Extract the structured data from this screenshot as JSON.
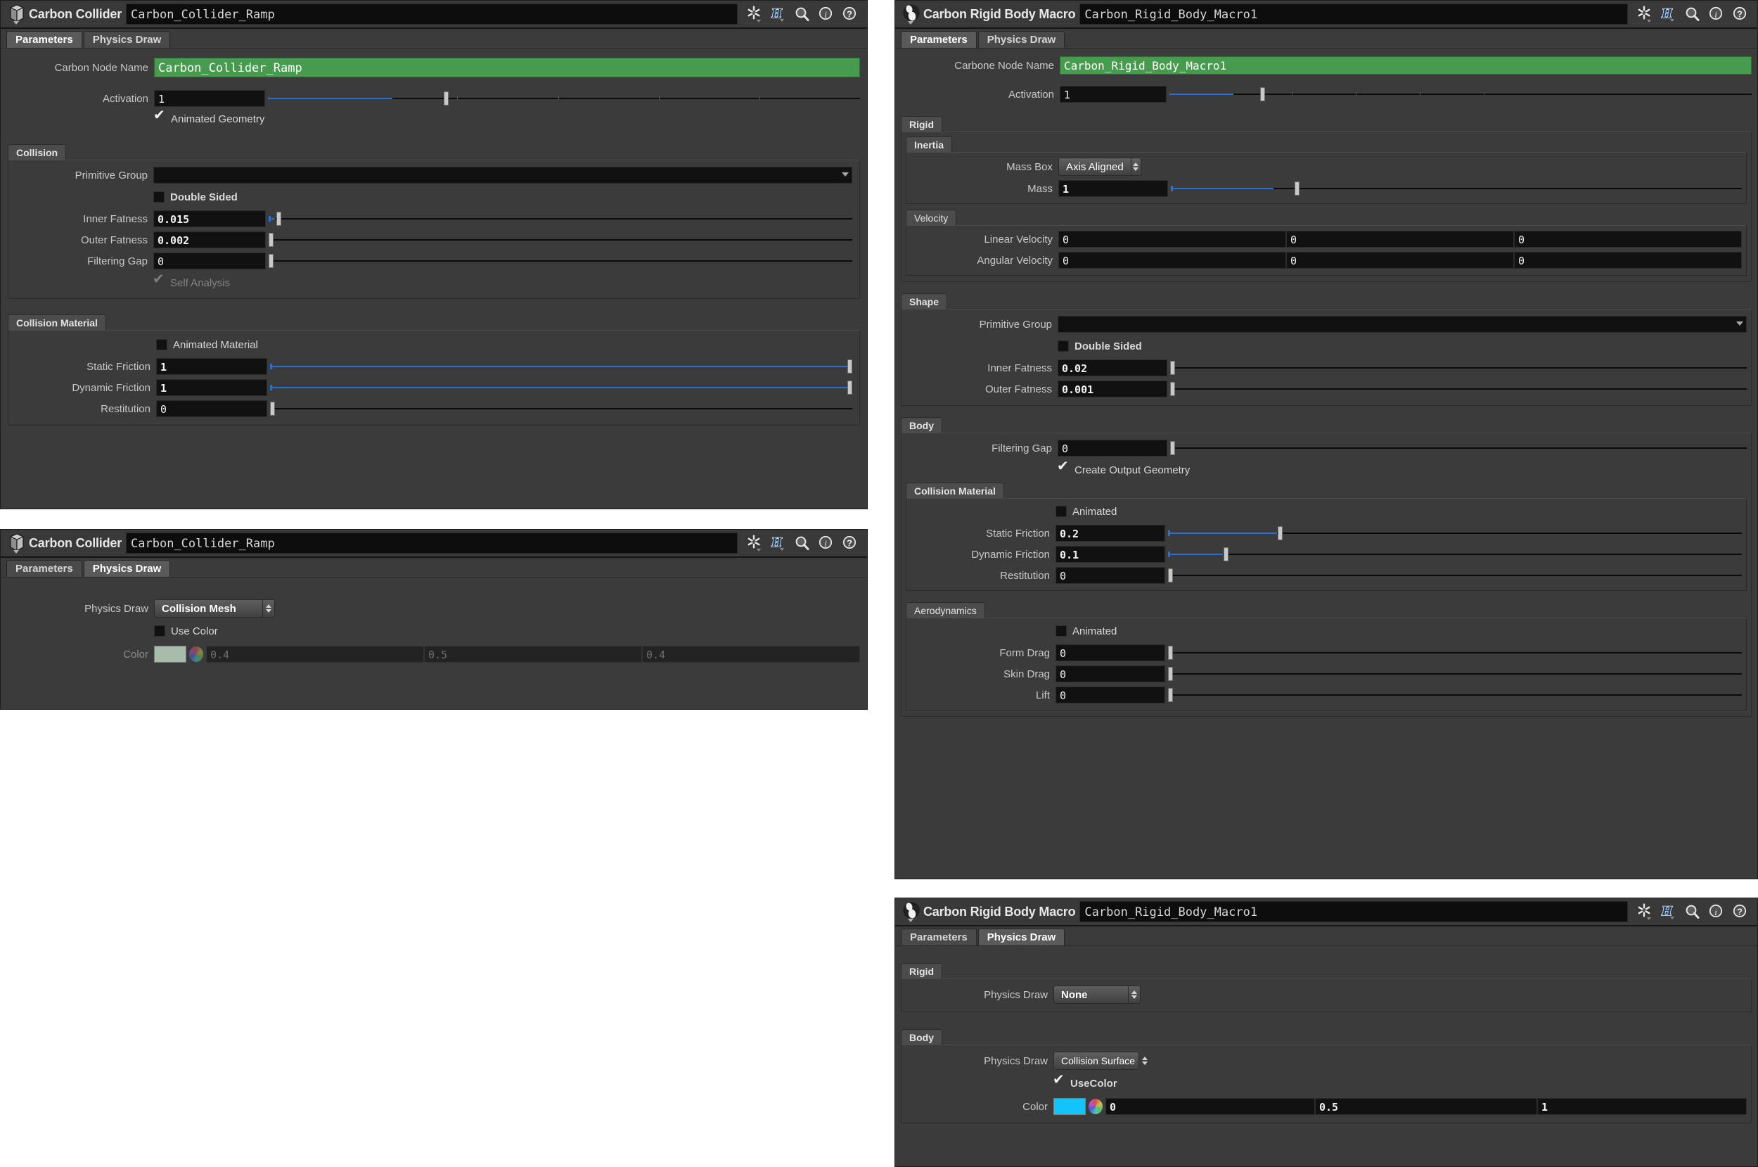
{
  "panels": {
    "collider_params": {
      "title": "Carbon Collider",
      "node_path": "Carbon_Collider_Ramp",
      "node_icon": "box-node-icon",
      "tabs": [
        {
          "label": "Parameters",
          "selected": true
        },
        {
          "label": "Physics Draw",
          "selected": false
        }
      ],
      "toolbar_icons": [
        "gear-icon",
        "houdini-h-icon",
        "search-icon",
        "info-icon",
        "help-icon"
      ],
      "node_name": {
        "label": "Carbon Node Name",
        "value": "Carbon_Collider_Ramp",
        "color": "#479b4e"
      },
      "activation": {
        "label": "Activation",
        "value": "1",
        "fill_pct": 21,
        "knob_pct": 30
      },
      "animated_geometry": {
        "label": "Animated Geometry",
        "checked": true
      },
      "collision": {
        "group": "Collision",
        "primitive_group": {
          "label": "Primitive Group",
          "value": ""
        },
        "double_sided": {
          "label": "Double Sided",
          "checked": false
        },
        "inner_fatness": {
          "label": "Inner Fatness",
          "value": "0.015",
          "fill_pct": 2,
          "knob_pct": 2
        },
        "outer_fatness": {
          "label": "Outer Fatness",
          "value": "0.002",
          "fill_pct": 0,
          "knob_pct": 0
        },
        "filtering_gap": {
          "label": "Filtering Gap",
          "value": "0",
          "fill_pct": 0,
          "knob_pct": 0
        },
        "self_analysis": {
          "label": "Self Analysis",
          "checked": true,
          "disabled": true
        }
      },
      "collision_material": {
        "group": "Collision Material",
        "animated_material": {
          "label": "Animated Material",
          "checked": false
        },
        "static_friction": {
          "label": "Static Friction",
          "value": "1",
          "fill_pct": 100,
          "knob_pct": 100
        },
        "dynamic_friction": {
          "label": "Dynamic Friction",
          "value": "1",
          "fill_pct": 100,
          "knob_pct": 100
        },
        "restitution": {
          "label": "Restitution",
          "value": "0",
          "fill_pct": 0,
          "knob_pct": 0
        }
      }
    },
    "collider_draw": {
      "title": "Carbon Collider",
      "node_path": "Carbon_Collider_Ramp",
      "node_icon": "box-node-icon",
      "tabs": [
        {
          "label": "Parameters",
          "selected": false
        },
        {
          "label": "Physics Draw",
          "selected": true
        }
      ],
      "toolbar_icons": [
        "gear-icon",
        "houdini-h-icon",
        "search-icon",
        "info-icon",
        "help-icon"
      ],
      "physics_draw": {
        "label": "Physics Draw",
        "value": "Collision Mesh"
      },
      "use_color": {
        "label": "Use Color",
        "checked": false
      },
      "color": {
        "label": "Color",
        "swatch": "#a7bcaa",
        "r": "0.4",
        "g": "0.5",
        "b": "0.4",
        "disabled": true
      }
    },
    "rigid_params": {
      "title": "Carbon Rigid Body Macro",
      "node_path": "Carbon_Rigid_Body_Macro1",
      "node_icon": "rigid-body-node-icon",
      "tabs": [
        {
          "label": "Parameters",
          "selected": true
        },
        {
          "label": "Physics Draw",
          "selected": false
        }
      ],
      "toolbar_icons": [
        "gear-icon",
        "houdini-h-icon",
        "search-icon",
        "info-icon",
        "help-icon"
      ],
      "node_name": {
        "label": "Carbone Node Name",
        "value": "Carbon_Rigid_Body_Macro1",
        "color": "#479b4e"
      },
      "activation": {
        "label": "Activation",
        "value": "1",
        "fill_pct": 11,
        "knob_pct": 16
      },
      "rigid": {
        "group": "Rigid",
        "inertia": {
          "group": "Inertia",
          "mass_box": {
            "label": "Mass Box",
            "value": "Axis Aligned"
          },
          "mass": {
            "label": "Mass",
            "value": "1",
            "fill_pct": 18,
            "knob_pct": 22
          }
        },
        "velocity": {
          "group": "Velocity",
          "linear": {
            "label": "Linear Velocity",
            "x": "0",
            "y": "0",
            "z": "0"
          },
          "angular": {
            "label": "Angular Velocity",
            "x": "0",
            "y": "0",
            "z": "0"
          }
        }
      },
      "shape": {
        "group": "Shape",
        "primitive_group": {
          "label": "Primitive Group",
          "value": ""
        },
        "double_sided": {
          "label": "Double Sided",
          "checked": false
        },
        "inner_fatness": {
          "label": "Inner Fatness",
          "value": "0.02",
          "fill_pct": 0,
          "knob_pct": 0
        },
        "outer_fatness": {
          "label": "Outer Fatness",
          "value": "0.001",
          "fill_pct": 0,
          "knob_pct": 0
        }
      },
      "body": {
        "group": "Body",
        "filtering_gap": {
          "label": "Filtering Gap",
          "value": "0",
          "fill_pct": 0,
          "knob_pct": 0
        },
        "create_output_geometry": {
          "label": "Create Output Geometry",
          "checked": true
        },
        "collision_material": {
          "group": "Collision Material",
          "animated": {
            "label": "Animated",
            "checked": false
          },
          "static_friction": {
            "label": "Static Friction",
            "value": "0.2",
            "fill_pct": 20,
            "knob_pct": 20
          },
          "dynamic_friction": {
            "label": "Dynamic Friction",
            "value": "0.1",
            "fill_pct": 10,
            "knob_pct": 10
          },
          "restitution": {
            "label": "Restitution",
            "value": "0",
            "fill_pct": 0,
            "knob_pct": 0
          }
        },
        "aerodynamics": {
          "group": "Aerodynamics",
          "animated": {
            "label": "Animated",
            "checked": false
          },
          "form_drag": {
            "label": "Form Drag",
            "value": "0",
            "fill_pct": 0,
            "knob_pct": 0
          },
          "skin_drag": {
            "label": "Skin Drag",
            "value": "0",
            "fill_pct": 0,
            "knob_pct": 0
          },
          "lift": {
            "label": "Lift",
            "value": "0",
            "fill_pct": 0,
            "knob_pct": 0
          }
        }
      }
    },
    "rigid_draw": {
      "title": "Carbon Rigid Body Macro",
      "node_path": "Carbon_Rigid_Body_Macro1",
      "node_icon": "rigid-body-node-icon",
      "tabs": [
        {
          "label": "Parameters",
          "selected": false
        },
        {
          "label": "Physics Draw",
          "selected": true
        }
      ],
      "toolbar_icons": [
        "gear-icon",
        "houdini-h-icon",
        "search-icon",
        "info-icon",
        "help-icon"
      ],
      "rigid": {
        "group": "Rigid",
        "physics_draw": {
          "label": "Physics Draw",
          "value": "None"
        }
      },
      "body": {
        "group": "Body",
        "physics_draw": {
          "label": "Physics Draw",
          "value": "Collision Surface"
        },
        "use_color": {
          "label": "UseColor",
          "checked": true
        },
        "color": {
          "label": "Color",
          "swatch": "#13c3fb",
          "r": "0",
          "g": "0.5",
          "b": "1",
          "disabled": false
        }
      }
    }
  },
  "theme": {
    "panel_bg": "#3b3b3b",
    "field_bg": "#111111",
    "accent_blue": "#2a6fd4",
    "node_name_green": "#479b4e",
    "page_bg": "#ffffff"
  }
}
